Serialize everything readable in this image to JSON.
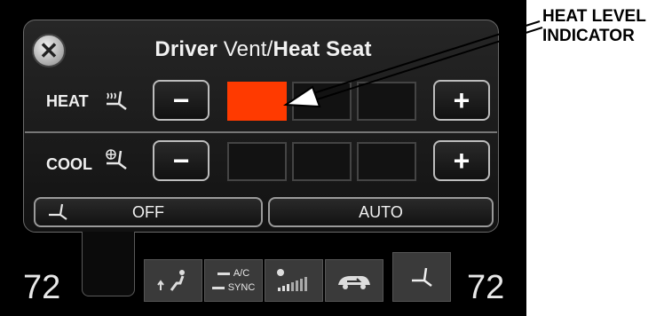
{
  "panel": {
    "title_light": "Driver",
    "title_bold1": "Vent",
    "title_sep": "/",
    "title_bold2": "Heat Seat",
    "close_glyph": "✕"
  },
  "heat": {
    "label": "HEAT",
    "minus": "−",
    "plus": "+",
    "level": 1,
    "max_level": 3,
    "active_color": "#ff3a00"
  },
  "cool": {
    "label": "COOL",
    "minus": "−",
    "plus": "+",
    "level": 0,
    "max_level": 3
  },
  "bottom_buttons": {
    "off": "OFF",
    "auto": "AUTO"
  },
  "climate": {
    "left_temp": "72",
    "right_temp": "72",
    "ac_label": "A/C",
    "sync_label": "SYNC",
    "icons": [
      "vent-mode-icon",
      "fan-speed-icon",
      "recirculation-icon",
      "seat-icon"
    ]
  },
  "annotation": {
    "line1": "HEAT LEVEL",
    "line2": "INDICATOR"
  }
}
